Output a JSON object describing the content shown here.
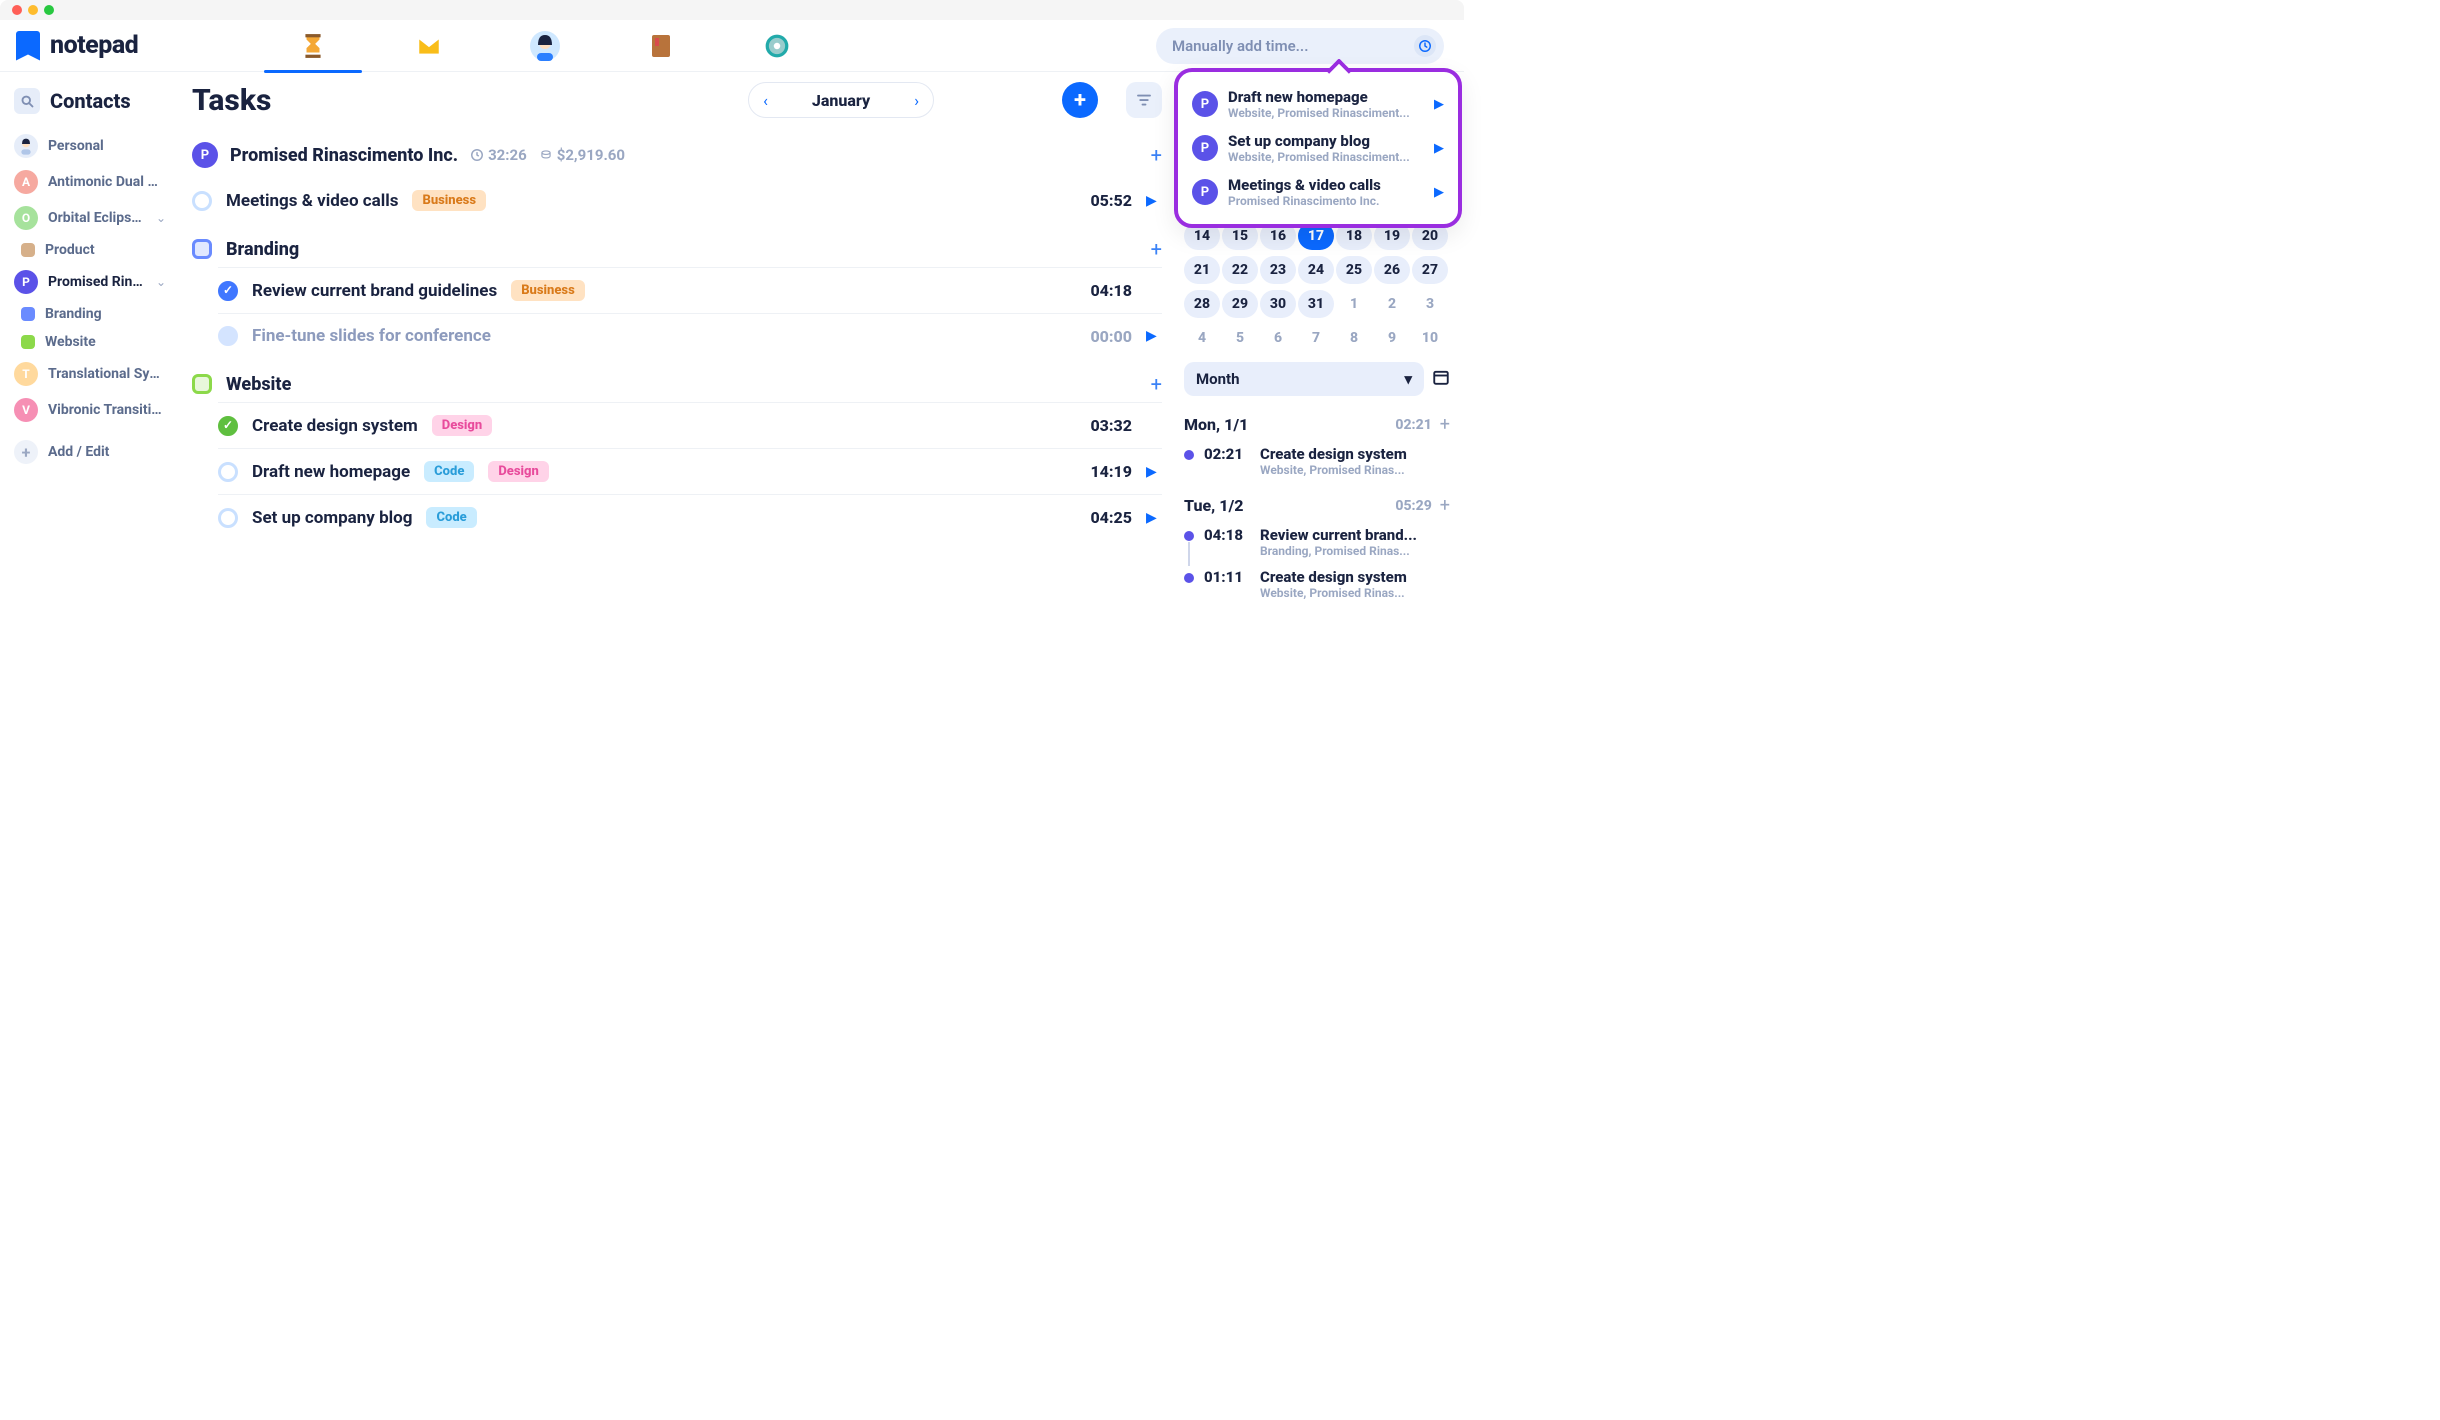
{
  "app": {
    "name": "notepad"
  },
  "header": {
    "time_placeholder": "Manually add time..."
  },
  "sidebar": {
    "title": "Contacts",
    "personal": "Personal",
    "add_edit": "Add / Edit",
    "items": [
      {
        "label": "Antimonic Dual AG",
        "color": "#f6a9a0",
        "initial": "A"
      },
      {
        "label": "Orbital Eclipse LLC",
        "color": "#a6e29c",
        "initial": "O",
        "expandable": true,
        "children": [
          {
            "label": "Product",
            "color": "#d6b08a"
          }
        ]
      },
      {
        "label": "Promised Rinascimen...",
        "full": "Promised Rinascimento Inc.",
        "color": "#5b52e8",
        "initial": "P",
        "selected": true,
        "expandable": true,
        "children": [
          {
            "label": "Branding",
            "color": "#6a8bff"
          },
          {
            "label": "Website",
            "color": "#8cd94a"
          }
        ]
      },
      {
        "label": "Translational Symmet...",
        "color": "#ffd99d",
        "initial": "T"
      },
      {
        "label": "Vibronic Transition G...",
        "color": "#f68fb4",
        "initial": "V"
      }
    ]
  },
  "main": {
    "title": "Tasks",
    "month": "January",
    "project": {
      "initial": "P",
      "name": "Promised Rinascimento Inc.",
      "time": "32:26",
      "amount": "$2,919.60"
    },
    "top_tasks": [
      {
        "name": "Meetings & video calls",
        "tags": [
          "Business"
        ],
        "time": "05:52",
        "play": true
      }
    ],
    "groups": [
      {
        "name": "Branding",
        "color": "#6a8bff",
        "tasks": [
          {
            "name": "Review current brand guidelines",
            "done": "blue",
            "tags": [
              "Business"
            ],
            "time": "04:18"
          },
          {
            "name": "Fine-tune slides for conference",
            "muted": true,
            "faint": true,
            "time": "00:00",
            "play": true
          }
        ]
      },
      {
        "name": "Website",
        "color": "#8cd94a",
        "tasks": [
          {
            "name": "Create design system",
            "done": "green",
            "tags": [
              "Design"
            ],
            "time": "03:32"
          },
          {
            "name": "Draft new homepage",
            "tags": [
              "Code",
              "Design"
            ],
            "time": "14:19",
            "play": true
          },
          {
            "name": "Set up company blog",
            "tags": [
              "Code"
            ],
            "time": "04:25",
            "play": true
          }
        ]
      }
    ]
  },
  "dropdown": [
    {
      "title": "Draft new homepage",
      "sub": "Website, Promised Rinasciment..."
    },
    {
      "title": "Set up company blog",
      "sub": "Website, Promised Rinasciment..."
    },
    {
      "title": "Meetings & video calls",
      "sub": "Promised Rinascimento Inc."
    }
  ],
  "calendar": {
    "weeks": [
      [
        {
          "n": "14"
        },
        {
          "n": "15"
        },
        {
          "n": "16"
        },
        {
          "n": "17",
          "sel": true
        },
        {
          "n": "18"
        },
        {
          "n": "19"
        },
        {
          "n": "20"
        }
      ],
      [
        {
          "n": "21"
        },
        {
          "n": "22"
        },
        {
          "n": "23"
        },
        {
          "n": "24"
        },
        {
          "n": "25"
        },
        {
          "n": "26"
        },
        {
          "n": "27"
        }
      ],
      [
        {
          "n": "28"
        },
        {
          "n": "29"
        },
        {
          "n": "30"
        },
        {
          "n": "31"
        },
        {
          "n": "1",
          "out": true
        },
        {
          "n": "2",
          "out": true
        },
        {
          "n": "3",
          "out": true
        }
      ],
      [
        {
          "n": "4",
          "out": true
        },
        {
          "n": "5",
          "out": true
        },
        {
          "n": "6",
          "out": true
        },
        {
          "n": "7",
          "out": true
        },
        {
          "n": "8",
          "out": true
        },
        {
          "n": "9",
          "out": true
        },
        {
          "n": "10",
          "out": true
        }
      ]
    ],
    "range": "Month"
  },
  "timeline": [
    {
      "day": "Mon, 1/1",
      "total": "02:21",
      "entries": [
        {
          "time": "02:21",
          "title": "Create design system",
          "sub": "Website, Promised Rinas..."
        }
      ]
    },
    {
      "day": "Tue, 1/2",
      "total": "05:29",
      "entries": [
        {
          "time": "04:18",
          "title": "Review current brand...",
          "sub": "Branding, Promised Rinas...",
          "line": true
        },
        {
          "time": "01:11",
          "title": "Create design system",
          "sub": "Website, Promised Rinas..."
        }
      ]
    }
  ],
  "colors": {
    "accent": "#0b69ff",
    "purple": "#5b52e8",
    "dropdown_border": "#9a2de0"
  }
}
